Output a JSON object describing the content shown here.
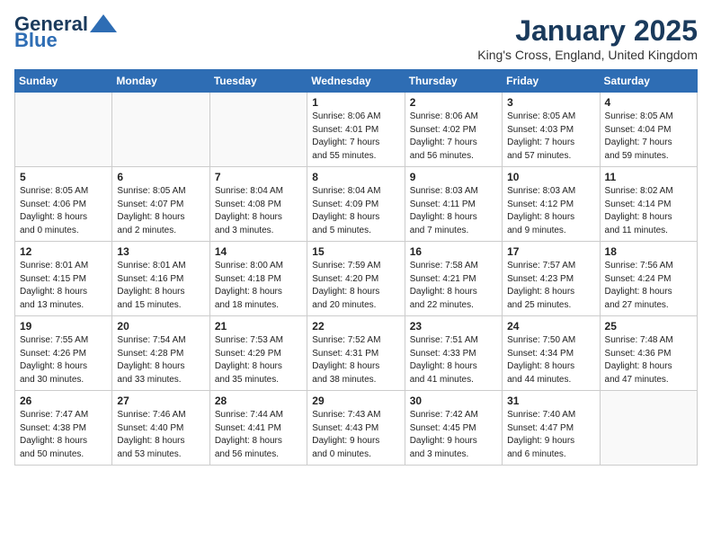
{
  "header": {
    "logo_line1": "General",
    "logo_line2": "Blue",
    "title": "January 2025",
    "subtitle": "King's Cross, England, United Kingdom"
  },
  "weekdays": [
    "Sunday",
    "Monday",
    "Tuesday",
    "Wednesday",
    "Thursday",
    "Friday",
    "Saturday"
  ],
  "weeks": [
    [
      {
        "day": "",
        "info": ""
      },
      {
        "day": "",
        "info": ""
      },
      {
        "day": "",
        "info": ""
      },
      {
        "day": "1",
        "info": "Sunrise: 8:06 AM\nSunset: 4:01 PM\nDaylight: 7 hours\nand 55 minutes."
      },
      {
        "day": "2",
        "info": "Sunrise: 8:06 AM\nSunset: 4:02 PM\nDaylight: 7 hours\nand 56 minutes."
      },
      {
        "day": "3",
        "info": "Sunrise: 8:05 AM\nSunset: 4:03 PM\nDaylight: 7 hours\nand 57 minutes."
      },
      {
        "day": "4",
        "info": "Sunrise: 8:05 AM\nSunset: 4:04 PM\nDaylight: 7 hours\nand 59 minutes."
      }
    ],
    [
      {
        "day": "5",
        "info": "Sunrise: 8:05 AM\nSunset: 4:06 PM\nDaylight: 8 hours\nand 0 minutes."
      },
      {
        "day": "6",
        "info": "Sunrise: 8:05 AM\nSunset: 4:07 PM\nDaylight: 8 hours\nand 2 minutes."
      },
      {
        "day": "7",
        "info": "Sunrise: 8:04 AM\nSunset: 4:08 PM\nDaylight: 8 hours\nand 3 minutes."
      },
      {
        "day": "8",
        "info": "Sunrise: 8:04 AM\nSunset: 4:09 PM\nDaylight: 8 hours\nand 5 minutes."
      },
      {
        "day": "9",
        "info": "Sunrise: 8:03 AM\nSunset: 4:11 PM\nDaylight: 8 hours\nand 7 minutes."
      },
      {
        "day": "10",
        "info": "Sunrise: 8:03 AM\nSunset: 4:12 PM\nDaylight: 8 hours\nand 9 minutes."
      },
      {
        "day": "11",
        "info": "Sunrise: 8:02 AM\nSunset: 4:14 PM\nDaylight: 8 hours\nand 11 minutes."
      }
    ],
    [
      {
        "day": "12",
        "info": "Sunrise: 8:01 AM\nSunset: 4:15 PM\nDaylight: 8 hours\nand 13 minutes."
      },
      {
        "day": "13",
        "info": "Sunrise: 8:01 AM\nSunset: 4:16 PM\nDaylight: 8 hours\nand 15 minutes."
      },
      {
        "day": "14",
        "info": "Sunrise: 8:00 AM\nSunset: 4:18 PM\nDaylight: 8 hours\nand 18 minutes."
      },
      {
        "day": "15",
        "info": "Sunrise: 7:59 AM\nSunset: 4:20 PM\nDaylight: 8 hours\nand 20 minutes."
      },
      {
        "day": "16",
        "info": "Sunrise: 7:58 AM\nSunset: 4:21 PM\nDaylight: 8 hours\nand 22 minutes."
      },
      {
        "day": "17",
        "info": "Sunrise: 7:57 AM\nSunset: 4:23 PM\nDaylight: 8 hours\nand 25 minutes."
      },
      {
        "day": "18",
        "info": "Sunrise: 7:56 AM\nSunset: 4:24 PM\nDaylight: 8 hours\nand 27 minutes."
      }
    ],
    [
      {
        "day": "19",
        "info": "Sunrise: 7:55 AM\nSunset: 4:26 PM\nDaylight: 8 hours\nand 30 minutes."
      },
      {
        "day": "20",
        "info": "Sunrise: 7:54 AM\nSunset: 4:28 PM\nDaylight: 8 hours\nand 33 minutes."
      },
      {
        "day": "21",
        "info": "Sunrise: 7:53 AM\nSunset: 4:29 PM\nDaylight: 8 hours\nand 35 minutes."
      },
      {
        "day": "22",
        "info": "Sunrise: 7:52 AM\nSunset: 4:31 PM\nDaylight: 8 hours\nand 38 minutes."
      },
      {
        "day": "23",
        "info": "Sunrise: 7:51 AM\nSunset: 4:33 PM\nDaylight: 8 hours\nand 41 minutes."
      },
      {
        "day": "24",
        "info": "Sunrise: 7:50 AM\nSunset: 4:34 PM\nDaylight: 8 hours\nand 44 minutes."
      },
      {
        "day": "25",
        "info": "Sunrise: 7:48 AM\nSunset: 4:36 PM\nDaylight: 8 hours\nand 47 minutes."
      }
    ],
    [
      {
        "day": "26",
        "info": "Sunrise: 7:47 AM\nSunset: 4:38 PM\nDaylight: 8 hours\nand 50 minutes."
      },
      {
        "day": "27",
        "info": "Sunrise: 7:46 AM\nSunset: 4:40 PM\nDaylight: 8 hours\nand 53 minutes."
      },
      {
        "day": "28",
        "info": "Sunrise: 7:44 AM\nSunset: 4:41 PM\nDaylight: 8 hours\nand 56 minutes."
      },
      {
        "day": "29",
        "info": "Sunrise: 7:43 AM\nSunset: 4:43 PM\nDaylight: 9 hours\nand 0 minutes."
      },
      {
        "day": "30",
        "info": "Sunrise: 7:42 AM\nSunset: 4:45 PM\nDaylight: 9 hours\nand 3 minutes."
      },
      {
        "day": "31",
        "info": "Sunrise: 7:40 AM\nSunset: 4:47 PM\nDaylight: 9 hours\nand 6 minutes."
      },
      {
        "day": "",
        "info": ""
      }
    ]
  ]
}
